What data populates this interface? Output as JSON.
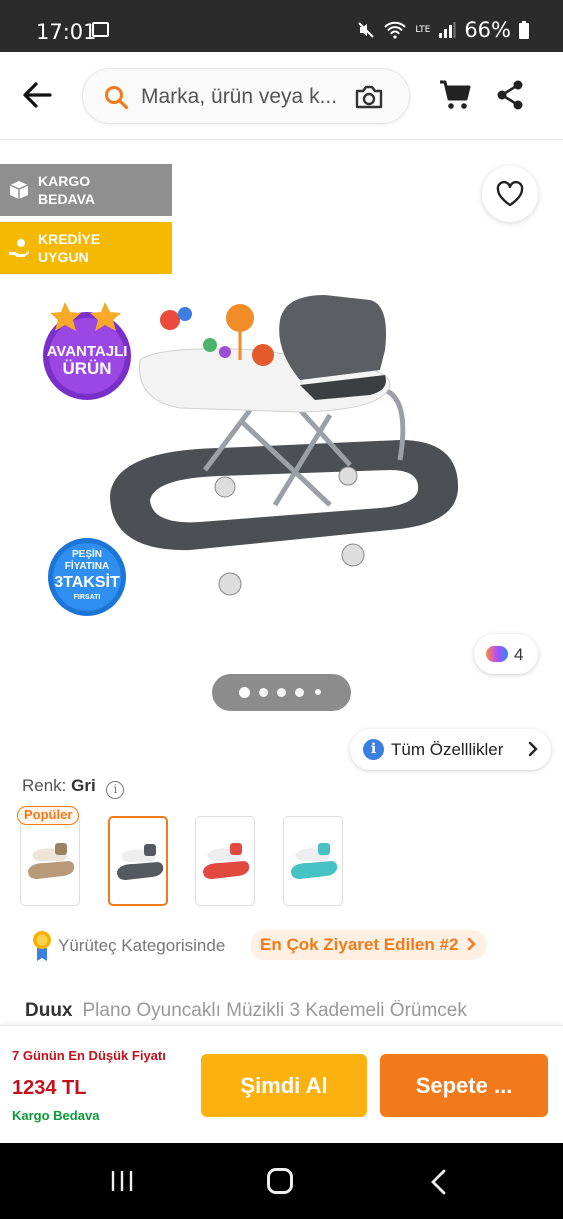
{
  "status_bar": {
    "time": "17:01",
    "network": "LTE",
    "battery": "66%"
  },
  "header": {
    "search_placeholder": "Marka, ürün veya k..."
  },
  "badges": {
    "cargo": "KARGO BEDAVA",
    "credit": "KREDİYE UYGUN"
  },
  "promo": {
    "advantage": [
      "AVANTAJLI",
      "ÜRÜN"
    ],
    "installment": [
      "PEŞİN",
      "FİYATINA",
      "3TAKSİT",
      "FIRSATI"
    ]
  },
  "gallery": {
    "color_count": "4",
    "page_count": 5,
    "current_page": 1
  },
  "all_features": "Tüm Özelllikler",
  "color": {
    "label": "Renk:",
    "value": "Gri"
  },
  "variants": {
    "popular_label": "Popüler",
    "items": [
      {
        "color": "#b89a78"
      },
      {
        "color": "#555a60"
      },
      {
        "color": "#e04a3f"
      },
      {
        "color": "#46c1c4"
      }
    ],
    "selected_index": 1
  },
  "category": {
    "text": "Yürüteç Kategorisinde",
    "rank": "En Çok Ziyaret Edilen #2"
  },
  "product": {
    "brand": "Duux",
    "name": "Plano Oyuncaklı Müzikli 3 Kademeli Örümcek"
  },
  "buy_bar": {
    "lowest_label": "7 Günün En Düşük Fiyatı",
    "price": "1234 TL",
    "shipping": "Kargo Bedava",
    "buy_now": "Şimdi Al",
    "add_to_cart": "Sepete ..."
  },
  "colors": {
    "accent": "#f27a1a",
    "buy_now": "#fbb110",
    "price": "#c2111d",
    "free": "#0b9a37"
  }
}
